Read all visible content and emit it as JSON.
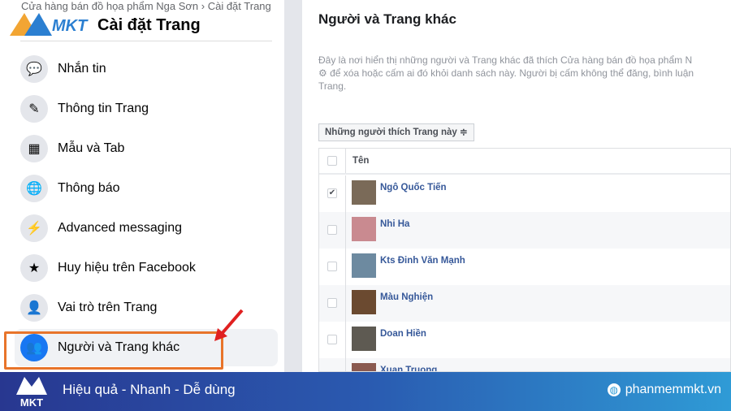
{
  "breadcrumb": "Cửa hàng bán đồ họa phẩm Nga Sơn › Cài đặt Trang",
  "page_title": "Cài đặt Trang",
  "logo_text": "MKT",
  "sidebar": {
    "items": [
      {
        "label": "Nhắn tin",
        "icon": "chat-bubble-icon",
        "glyph": "💬"
      },
      {
        "label": "Thông tin Trang",
        "icon": "pencil-icon",
        "glyph": "✎"
      },
      {
        "label": "Mẫu và Tab",
        "icon": "grid-icon",
        "glyph": "▦"
      },
      {
        "label": "Thông báo",
        "icon": "globe-icon",
        "glyph": "🌐"
      },
      {
        "label": "Advanced messaging",
        "icon": "messenger-icon",
        "glyph": "⚡"
      },
      {
        "label": "Huy hiệu trên Facebook",
        "icon": "star-badge-icon",
        "glyph": "★"
      },
      {
        "label": "Vai trò trên Trang",
        "icon": "person-icon",
        "glyph": "👤"
      },
      {
        "label": "Người và Trang khác",
        "icon": "people-icon",
        "glyph": "👥",
        "active": true
      }
    ]
  },
  "main": {
    "title": "Người và Trang khác",
    "description": [
      "Đây là nơi hiển thị những người và Trang khác đã thích Cửa hàng bán đồ họa phẩm N",
      "⚙ để xóa hoặc cấm ai đó khỏi danh sách này. Người bị cấm không thể đăng, bình luận",
      "Trang."
    ],
    "filter": "Những người thích Trang này ≑",
    "table": {
      "header": "Tên",
      "rows": [
        {
          "name": "Ngô Quốc Tiến",
          "checked": true,
          "color": "#7a6a58"
        },
        {
          "name": "Nhi Ha",
          "checked": false,
          "color": "#c98a90"
        },
        {
          "name": "Kts Đinh Văn Mạnh",
          "checked": false,
          "color": "#6d8aa0"
        },
        {
          "name": "Màu Nghiện",
          "checked": false,
          "color": "#6b4a30"
        },
        {
          "name": "Doan Hiền",
          "checked": false,
          "color": "#5e5a52"
        },
        {
          "name": "Xuan Truong",
          "checked": false,
          "color": "#8a5a50"
        }
      ]
    }
  },
  "banner": {
    "slogan": "Hiệu quả - Nhanh  - Dễ dùng",
    "website": "phanmemmkt.vn",
    "logo": "MKT"
  },
  "colors": {
    "accent": "#1877f2",
    "highlight": "#e8742a",
    "arrow": "#e02020"
  }
}
